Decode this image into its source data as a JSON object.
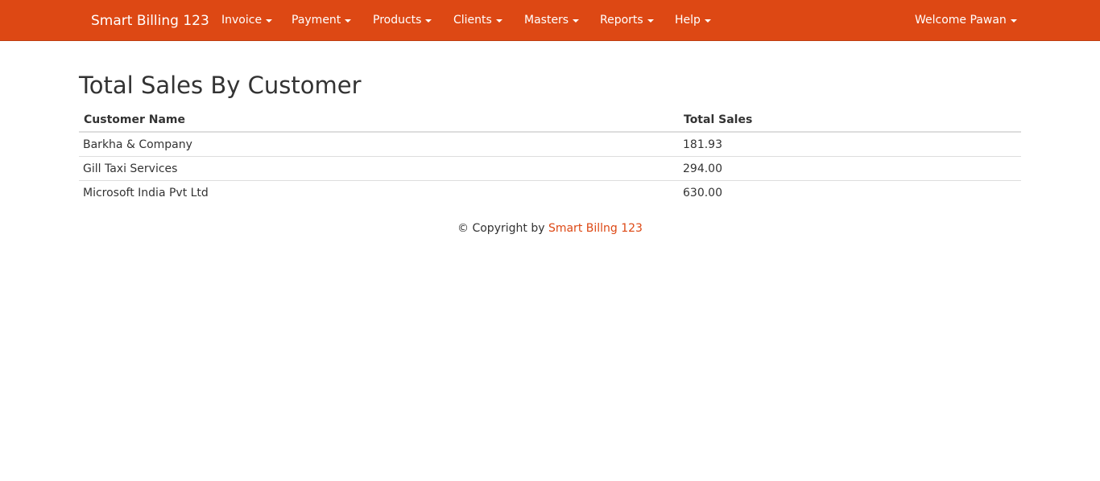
{
  "navbar": {
    "brand": "Smart Billing 123",
    "menu": [
      {
        "label": "Invoice"
      },
      {
        "label": "Payment"
      },
      {
        "label": "Products"
      },
      {
        "label": "Clients"
      },
      {
        "label": "Masters"
      },
      {
        "label": "Reports"
      },
      {
        "label": "Help"
      }
    ],
    "user_menu": "Welcome Pawan",
    "background_color": "#dd4814"
  },
  "page": {
    "title": "Total Sales By Customer"
  },
  "table": {
    "headers": [
      "Customer Name",
      "Total Sales"
    ],
    "rows": [
      {
        "customer": "Barkha & Company",
        "total": "181.93"
      },
      {
        "customer": "Gill Taxi Services",
        "total": "294.00"
      },
      {
        "customer": "Microsoft India Pvt Ltd",
        "total": "630.00"
      }
    ]
  },
  "footer": {
    "prefix": "© Copyright by",
    "link_text": "Smart Billng 123",
    "link_color": "#dd4814"
  }
}
